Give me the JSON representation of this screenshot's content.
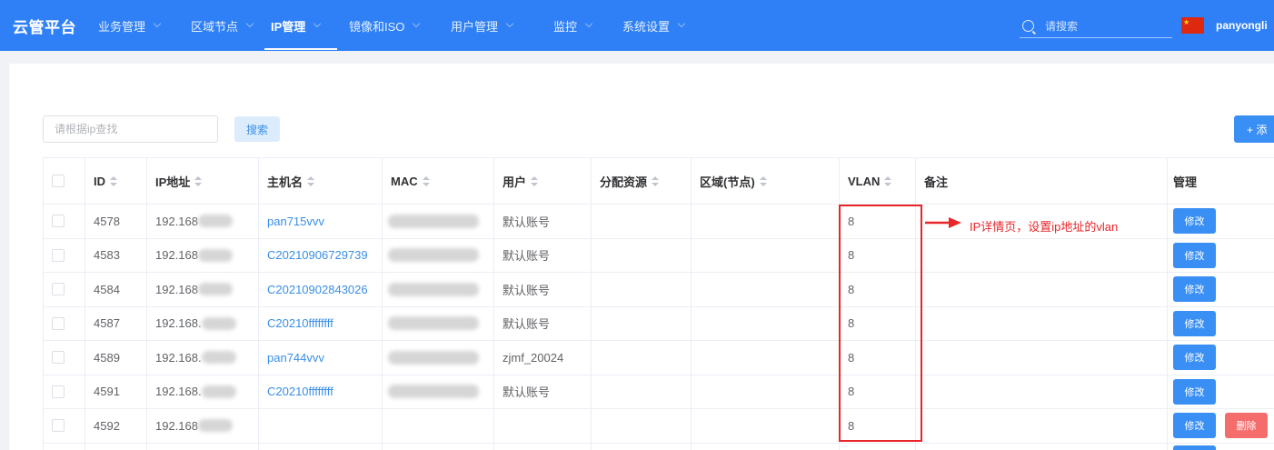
{
  "nav": {
    "brand": "云管平台",
    "items": [
      {
        "label": "业务管理",
        "active": false
      },
      {
        "label": "区域节点",
        "active": false
      },
      {
        "label": "IP管理",
        "active": true
      },
      {
        "label": "镜像和ISO",
        "active": false
      },
      {
        "label": "用户管理",
        "active": false
      },
      {
        "label": "监控",
        "active": false
      },
      {
        "label": "系统设置",
        "active": false
      }
    ],
    "search": {
      "placeholder": "请搜索"
    },
    "username": "panyongli"
  },
  "toolbar": {
    "ip_search_placeholder": "请根据ip查找",
    "search_button": "搜索",
    "add_button": "+ 添"
  },
  "table": {
    "columns": [
      {
        "label": "ID",
        "sortable": true
      },
      {
        "label": "IP地址",
        "sortable": true
      },
      {
        "label": "主机名",
        "sortable": true
      },
      {
        "label": "MAC",
        "sortable": true
      },
      {
        "label": "用户",
        "sortable": true
      },
      {
        "label": "分配资源",
        "sortable": true
      },
      {
        "label": "区域(节点)",
        "sortable": true
      },
      {
        "label": "VLAN",
        "sortable": true
      },
      {
        "label": "备注",
        "sortable": false
      },
      {
        "label": "管理",
        "sortable": false
      }
    ],
    "rows": [
      {
        "id": "4578",
        "ip": "192.168",
        "hostname": "pan715vvv",
        "user": "默认账号",
        "vlan": "8",
        "actions": [
          "修改"
        ]
      },
      {
        "id": "4583",
        "ip": "192.168",
        "hostname": "C20210906729739",
        "user": "默认账号",
        "vlan": "8",
        "actions": [
          "修改"
        ]
      },
      {
        "id": "4584",
        "ip": "192.168",
        "hostname": "C20210902843026",
        "user": "默认账号",
        "vlan": "8",
        "actions": [
          "修改"
        ]
      },
      {
        "id": "4587",
        "ip": "192.168.",
        "hostname": "C20210ffffffff",
        "user": "默认账号",
        "vlan": "8",
        "actions": [
          "修改"
        ]
      },
      {
        "id": "4589",
        "ip": "192.168.",
        "hostname": "pan744vvv",
        "user": "zjmf_20024",
        "vlan": "8",
        "actions": [
          "修改"
        ]
      },
      {
        "id": "4591",
        "ip": "192.168.",
        "hostname": "C20210ffffffff",
        "user": "默认账号",
        "vlan": "8",
        "actions": [
          "修改"
        ]
      },
      {
        "id": "4592",
        "ip": "192.168",
        "vlan": "8",
        "actions": [
          "修改",
          "删除"
        ]
      }
    ]
  },
  "annotation": {
    "text": "IP详情页，设置ip地址的vlan"
  },
  "icons": {
    "search": "search-icon",
    "locale": "china-flag-icon",
    "dropdown": "chevron-down-icon",
    "sort": "sort-caret-icon",
    "annotation_arrow": "arrow-right-icon"
  },
  "colors": {
    "nav_background": "#2f80f6",
    "link": "#3a8ee6",
    "primary_button": "#3a8ff5",
    "danger_button": "#f56c6c",
    "annotation": "#e8262a"
  }
}
